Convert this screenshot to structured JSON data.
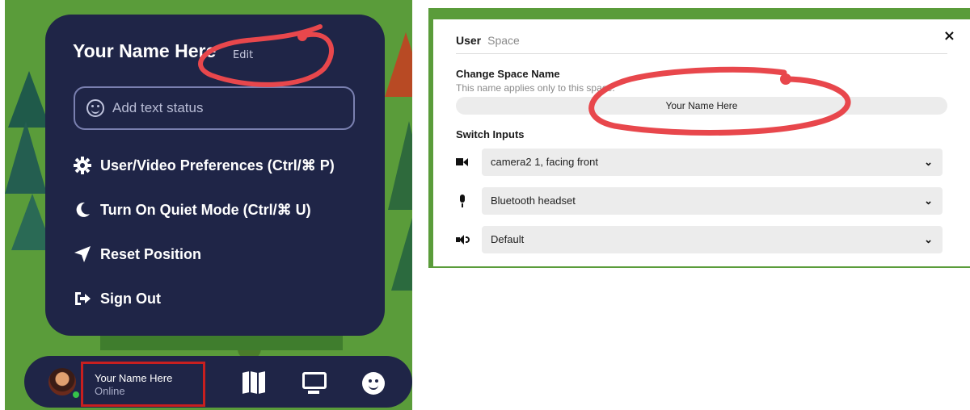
{
  "left_panel": {
    "menu": {
      "user_name": "Your Name Here",
      "edit_label": "Edit",
      "status_placeholder": "Add text status",
      "items": [
        {
          "icon": "gear-icon",
          "label": "User/Video Preferences (Ctrl/⌘ P)"
        },
        {
          "icon": "moon-icon",
          "label": "Turn On Quiet Mode (Ctrl/⌘ U)"
        },
        {
          "icon": "location-arrow-icon",
          "label": "Reset Position"
        },
        {
          "icon": "sign-out-icon",
          "label": "Sign Out"
        }
      ]
    },
    "bottom_bar": {
      "user_name": "Your Name Here",
      "status": "Online",
      "icons": [
        "map-icon",
        "screen-share-icon",
        "emoji-icon"
      ]
    }
  },
  "right_panel": {
    "tabs": {
      "user": "User",
      "space": "Space"
    },
    "close_label": "×",
    "change_name": {
      "title": "Change Space Name",
      "subtitle": "This name applies only to this space.",
      "value": "Your Name Here"
    },
    "switch_inputs": {
      "title": "Switch Inputs",
      "camera": "camera2 1, facing front",
      "microphone": "Bluetooth headset",
      "speaker": "Default"
    }
  },
  "colors": {
    "menu_bg": "#1f2547",
    "highlight_box": "#c81f1f",
    "scribble": "#e8474c",
    "grass": "#5a9c3a"
  }
}
